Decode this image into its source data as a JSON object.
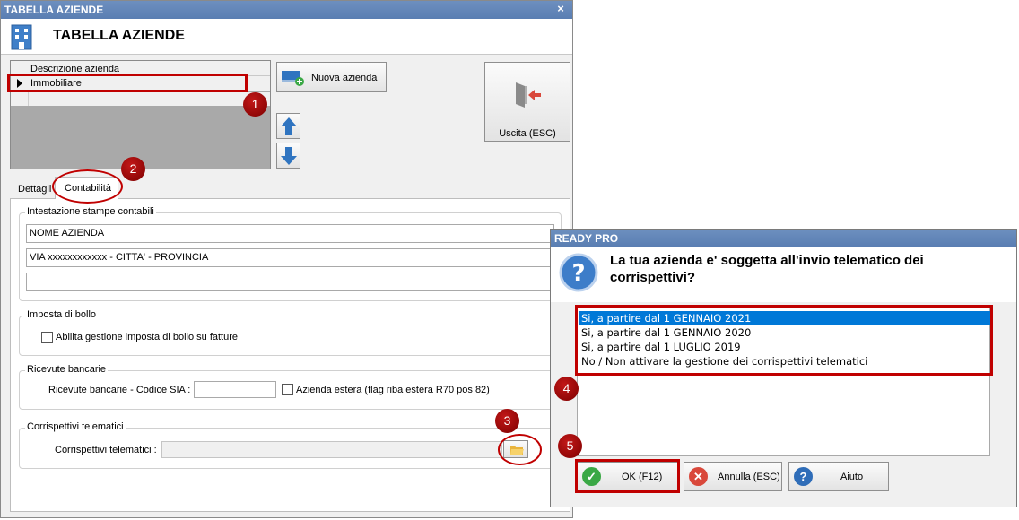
{
  "main_window": {
    "title": "TABELLA AZIENDE",
    "close_glyph": "×",
    "header_title": "TABELLA AZIENDE",
    "header_icon": "building-icon"
  },
  "grid": {
    "column_header": "Descrizione azienda",
    "rows": [
      "Immobiliare"
    ]
  },
  "buttons": {
    "new_company": "Nuova azienda",
    "exit": "Uscita (ESC)"
  },
  "tabs": [
    "Dettagli",
    "Contabilità"
  ],
  "groups": {
    "intestazione": {
      "title": "Intestazione stampe contabili",
      "line1": "NOME AZIENDA",
      "line2": "VIA xxxxxxxxxxxx - CITTA' - PROVINCIA",
      "line3": ""
    },
    "bollo": {
      "title": "Imposta di bollo",
      "checkbox_label": "Abilita gestione imposta di bollo su fatture",
      "checked": false
    },
    "ricevute": {
      "title": "Ricevute bancarie",
      "sia_label": "Ricevute bancarie - Codice SIA :",
      "sia_value": "",
      "foreign_label": "Azienda estera (flag riba estera R70 pos 82)",
      "foreign_checked": false
    },
    "corrispettivi": {
      "title": "Corrispettivi telematici",
      "field_label": "Corrispettivi telematici :",
      "field_value": ""
    }
  },
  "dialog": {
    "title": "READY PRO",
    "question": "La tua azienda e' soggetta all'invio telematico dei corrispettivi?",
    "options": [
      "Si, a partire dal 1 GENNAIO 2021",
      "Si, a partire dal 1 GENNAIO 2020",
      "Si, a partire dal 1 LUGLIO 2019",
      "No / Non attivare la gestione dei corrispettivi telematici"
    ],
    "selected_index": 0,
    "ok_label": "OK (F12)",
    "cancel_label": "Annulla (ESC)",
    "help_label": "Aiuto"
  },
  "markers": [
    "1",
    "2",
    "3",
    "4",
    "5"
  ],
  "colors": {
    "titlebar": "#5a7eb2",
    "selection": "#0078d7",
    "annotation": "#c00000"
  }
}
